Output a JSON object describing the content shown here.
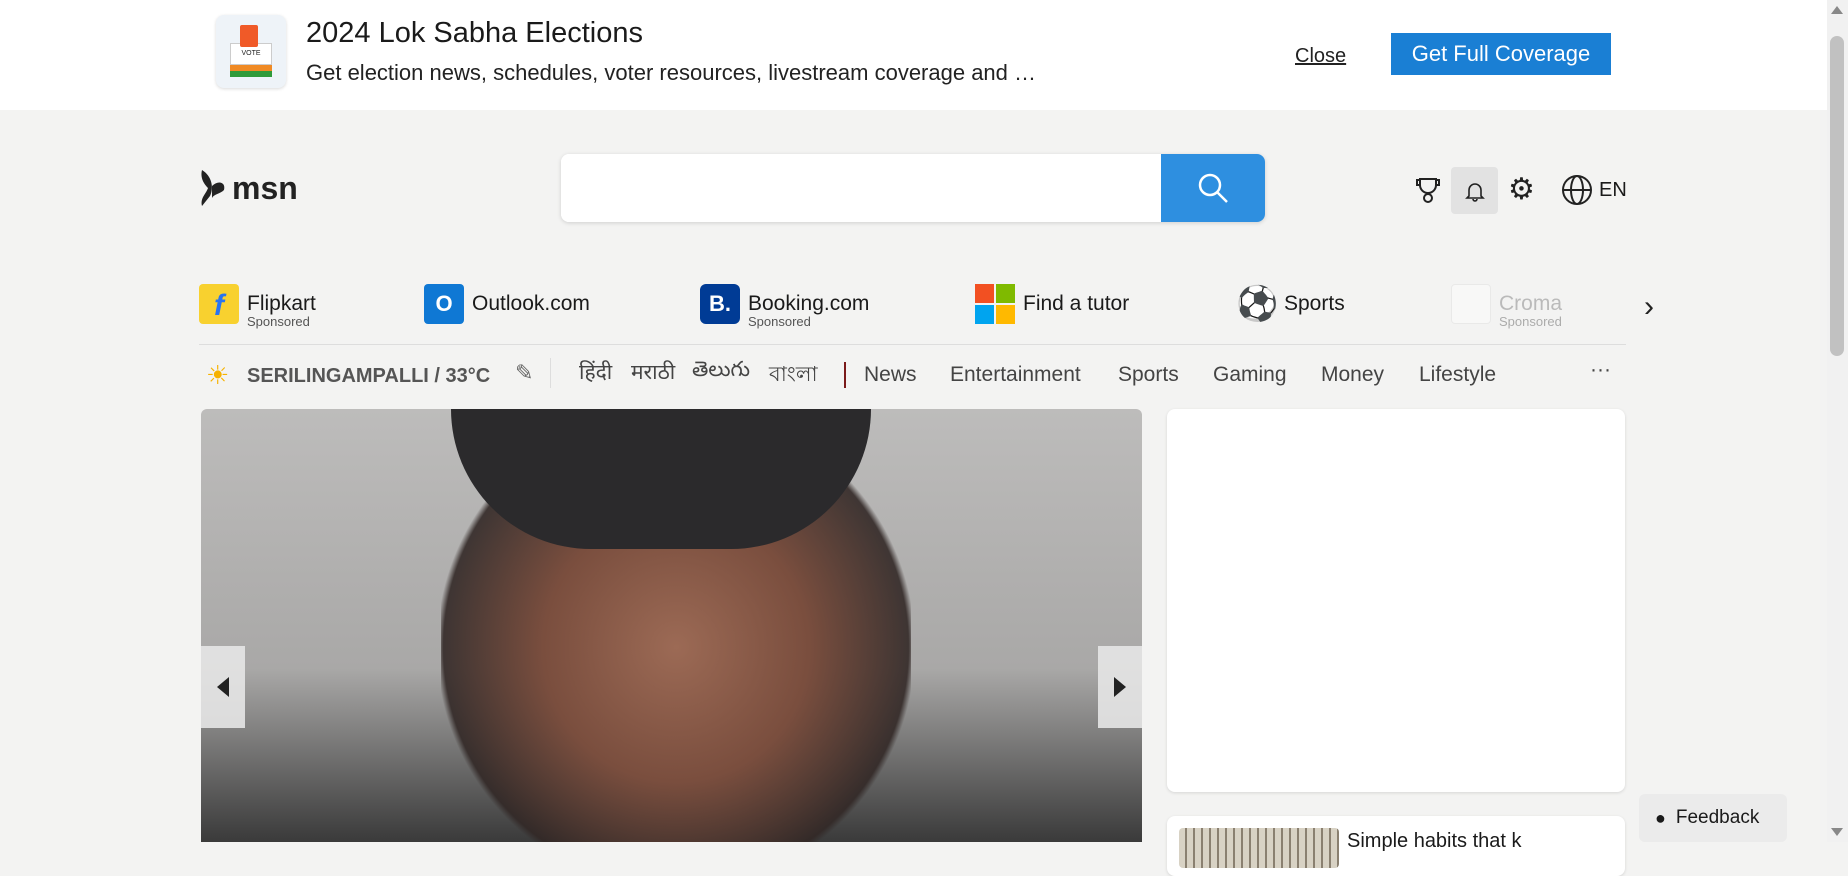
{
  "banner": {
    "title": "2024 Lok Sabha Elections",
    "subtitle": "Get election news, schedules, voter resources, livestream coverage and …",
    "close_label": "Close",
    "cta_label": "Get Full Coverage",
    "icon_text": "VOTE"
  },
  "header": {
    "logo": "msn",
    "search_placeholder": "",
    "language": "EN"
  },
  "shortcuts": [
    {
      "label": "Flipkart",
      "sub": "Sponsored"
    },
    {
      "label": "Outlook.com",
      "sub": ""
    },
    {
      "label": "Booking.com",
      "sub": "Sponsored",
      "icon_text": "B."
    },
    {
      "label": "Find a tutor",
      "sub": ""
    },
    {
      "label": "Sports",
      "sub": ""
    },
    {
      "label": "Croma",
      "sub": "Sponsored"
    }
  ],
  "navbar": {
    "weather": "SERILINGAMPALLI / 33°C",
    "languages": [
      "हिंदी",
      "मराठी",
      "తెలుగు",
      "বাংলা"
    ],
    "items": [
      "News",
      "Entertainment",
      "Sports",
      "Gaming",
      "Money",
      "Lifestyle"
    ],
    "more": "···"
  },
  "feedback_label": "Feedback",
  "teaser_text": "Simple habits that k",
  "colors": {
    "accent": "#2e8fe0",
    "cta": "#1a7fd4"
  }
}
